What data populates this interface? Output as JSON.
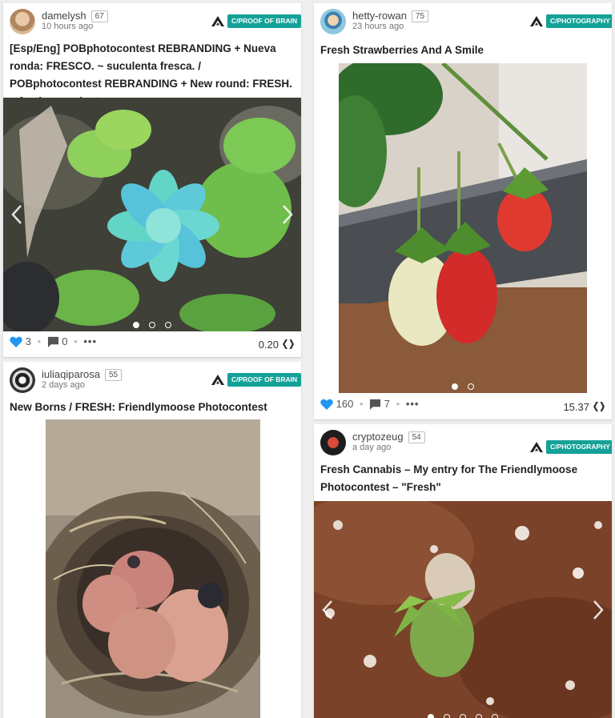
{
  "colors": {
    "accent": "#14a198",
    "vote": "#2196f3",
    "hive_black": "#212121"
  },
  "posts": [
    {
      "author": "damelysh",
      "reputation": "67",
      "time_ago": "10 hours ago",
      "community": "C/PROOF OF BRAIN",
      "title": "[Esp/Eng] POBphotocontest REBRANDING + Nueva ronda: FRESCO. ~ suculenta fresca. / POBphotocontest REBRANDING + New round: FRESH. ~ fresh succulent.",
      "image": "succulent-photo",
      "image_count": 3,
      "active_image": 1,
      "votes": "3",
      "comments": "0",
      "payout": "0.20",
      "more_icon": "more-icon"
    },
    {
      "author": "hetty-rowan",
      "reputation": "75",
      "time_ago": "23 hours ago",
      "community": "C/PHOTOGRAPHY",
      "title": "Fresh Strawberries And A Smile",
      "image": "strawberries-photo",
      "image_count": 2,
      "active_image": 1,
      "votes": "160",
      "comments": "7",
      "payout": "15.37",
      "more_icon": "more-icon"
    },
    {
      "author": "iuliaqiparosa",
      "reputation": "55",
      "time_ago": "2 days ago",
      "community": "C/PROOF OF BRAIN",
      "title": "New Borns / FRESH: Friendlymoose Photocontest",
      "image": "baby-birds-nest-photo"
    },
    {
      "author": "cryptozeug",
      "reputation": "54",
      "time_ago": "a day ago",
      "community": "C/PHOTOGRAPHY",
      "title": "Fresh Cannabis – My entry for The Friendlymoose Photocontest – \"Fresh\"",
      "image": "cannabis-seedling-photo",
      "image_count": 5,
      "active_image": 1
    }
  ]
}
